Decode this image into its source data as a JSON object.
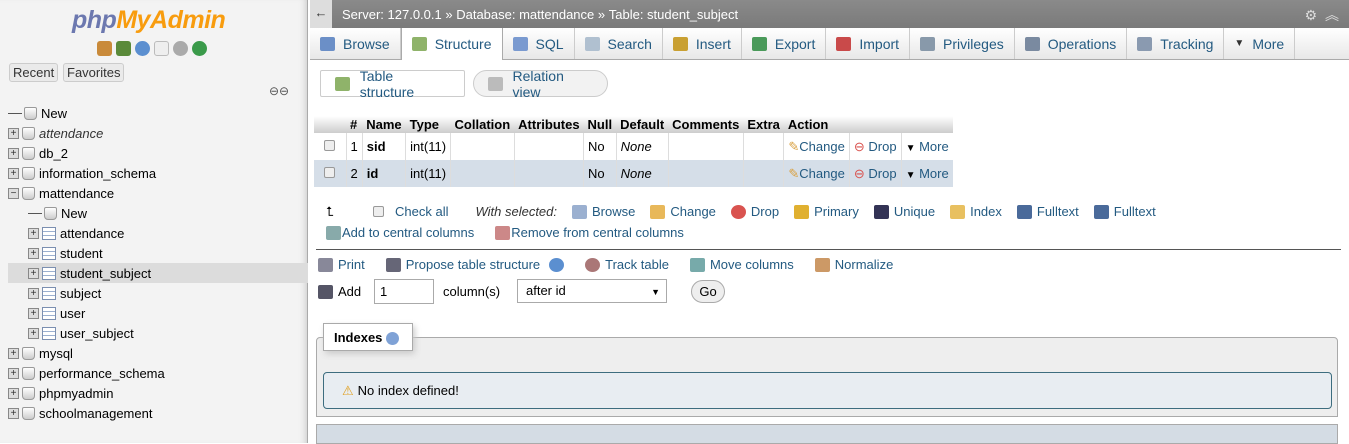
{
  "sidebar": {
    "logo_php": "php",
    "logo_myadmin": "MyAdmin",
    "recent": "Recent",
    "favorites": "Favorites",
    "tree": [
      {
        "label": "New",
        "level": 0,
        "kind": "new"
      },
      {
        "label": "attendance",
        "level": 0,
        "kind": "db",
        "italic": true
      },
      {
        "label": "db_2",
        "level": 0,
        "kind": "db"
      },
      {
        "label": "information_schema",
        "level": 0,
        "kind": "db"
      },
      {
        "label": "mattendance",
        "level": 0,
        "kind": "db",
        "expanded": true
      },
      {
        "label": "New",
        "level": 1,
        "kind": "new"
      },
      {
        "label": "attendance",
        "level": 1,
        "kind": "table"
      },
      {
        "label": "student",
        "level": 1,
        "kind": "table"
      },
      {
        "label": "student_subject",
        "level": 1,
        "kind": "table",
        "selected": true
      },
      {
        "label": "subject",
        "level": 1,
        "kind": "table"
      },
      {
        "label": "user",
        "level": 1,
        "kind": "table"
      },
      {
        "label": "user_subject",
        "level": 1,
        "kind": "table"
      },
      {
        "label": "mysql",
        "level": 0,
        "kind": "db"
      },
      {
        "label": "performance_schema",
        "level": 0,
        "kind": "db"
      },
      {
        "label": "phpmyadmin",
        "level": 0,
        "kind": "db"
      },
      {
        "label": "schoolmanagement",
        "level": 0,
        "kind": "db"
      }
    ]
  },
  "breadcrumb": {
    "server": "Server: 127.0.0.1",
    "sep": "»",
    "database": "Database: mattendance",
    "table": "Table: student_subject"
  },
  "tabs": [
    "Browse",
    "Structure",
    "SQL",
    "Search",
    "Insert",
    "Export",
    "Import",
    "Privileges",
    "Operations",
    "Tracking",
    "More"
  ],
  "subtabs": {
    "table_structure": "Table structure",
    "relation_view": "Relation view"
  },
  "table": {
    "headers": [
      "#",
      "Name",
      "Type",
      "Collation",
      "Attributes",
      "Null",
      "Default",
      "Comments",
      "Extra",
      "Action"
    ],
    "rows": [
      {
        "num": "1",
        "name": "sid",
        "type": "int(11)",
        "collation": "",
        "attributes": "",
        "null": "No",
        "default": "None",
        "comments": "",
        "extra": ""
      },
      {
        "num": "2",
        "name": "id",
        "type": "int(11)",
        "collation": "",
        "attributes": "",
        "null": "No",
        "default": "None",
        "comments": "",
        "extra": ""
      }
    ],
    "actions": {
      "change": "Change",
      "drop": "Drop",
      "more": "More"
    }
  },
  "bulk": {
    "check_all": "Check all",
    "with_selected": "With selected:",
    "browse": "Browse",
    "change": "Change",
    "drop": "Drop",
    "primary": "Primary",
    "unique": "Unique",
    "index": "Index",
    "fulltext1": "Fulltext",
    "fulltext2": "Fulltext",
    "add_central": "Add to central columns",
    "remove_central": "Remove from central columns"
  },
  "tools": {
    "print": "Print",
    "propose": "Propose table structure",
    "track": "Track table",
    "move": "Move columns",
    "normalize": "Normalize"
  },
  "add": {
    "label": "Add",
    "count": "1",
    "unit": "column(s)",
    "position": "after id",
    "go": "Go"
  },
  "indexes": {
    "legend": "Indexes",
    "notice": "No index defined!"
  }
}
